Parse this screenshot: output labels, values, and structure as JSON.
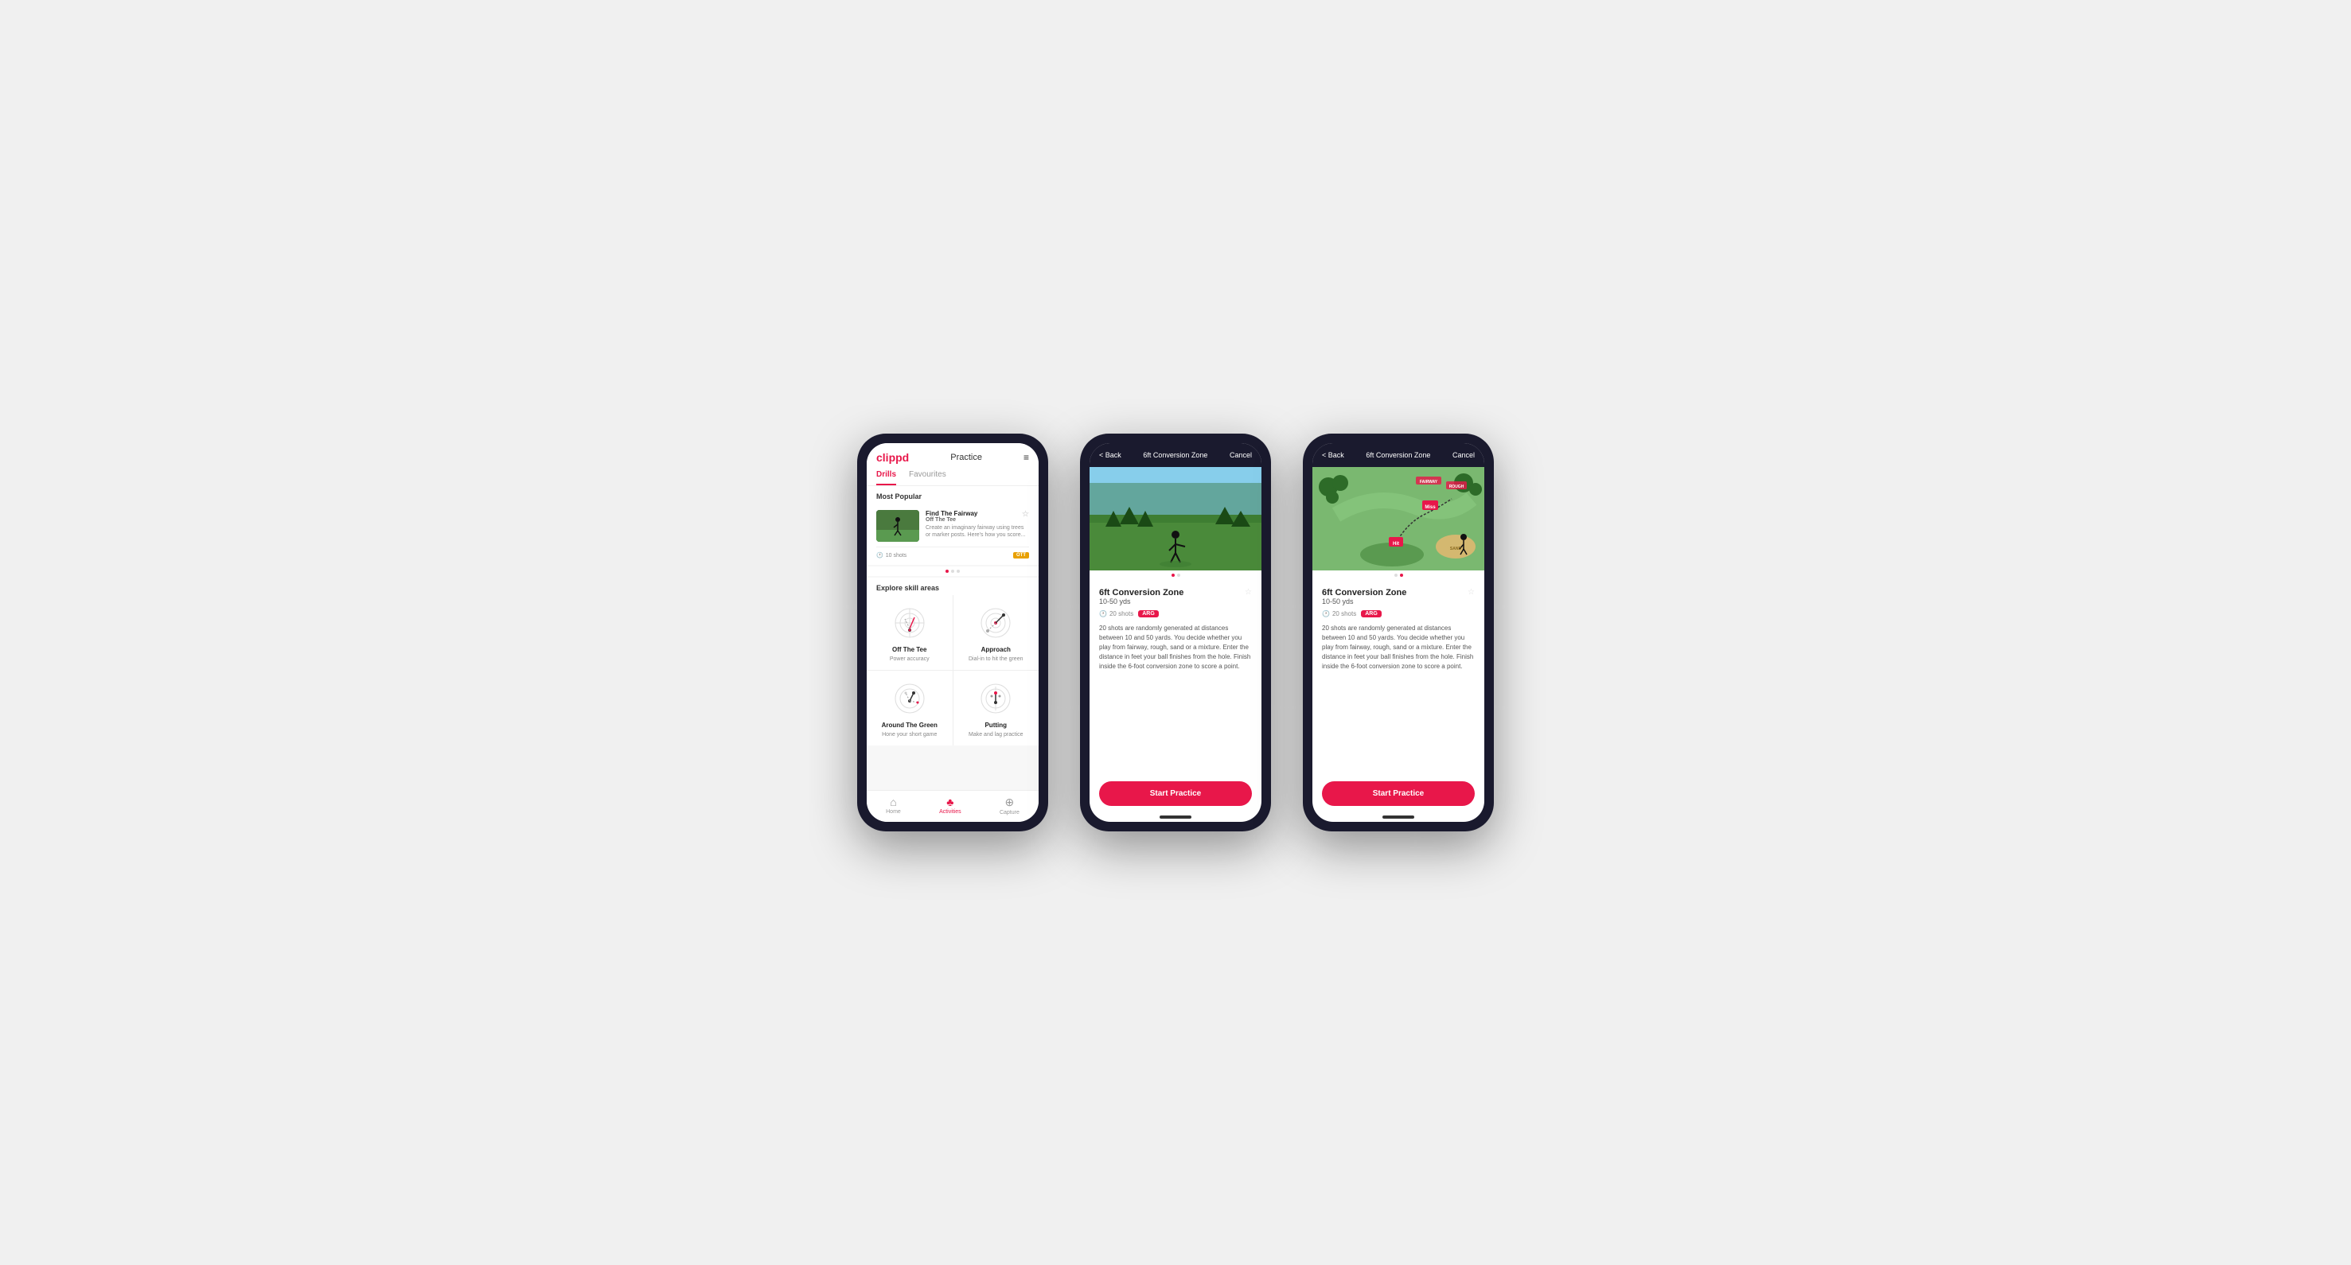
{
  "phone1": {
    "header": {
      "logo": "clippd",
      "nav_title": "Practice",
      "menu_icon": "≡"
    },
    "tabs": [
      {
        "label": "Drills",
        "active": true
      },
      {
        "label": "Favourites",
        "active": false
      }
    ],
    "most_popular_label": "Most Popular",
    "featured_drill": {
      "title": "Find The Fairway",
      "subtitle": "Off The Tee",
      "description": "Create an imaginary fairway using trees or marker posts. Here's how you score...",
      "shots": "10 shots",
      "badge": "OTT"
    },
    "explore_label": "Explore skill areas",
    "skill_areas": [
      {
        "name": "Off The Tee",
        "desc": "Power accuracy"
      },
      {
        "name": "Approach",
        "desc": "Dial-in to hit the green"
      },
      {
        "name": "Around The Green",
        "desc": "Hone your short game"
      },
      {
        "name": "Putting",
        "desc": "Make and lag practice"
      }
    ],
    "nav": [
      {
        "label": "Home",
        "icon": "⌂",
        "active": false
      },
      {
        "label": "Activities",
        "icon": "♣",
        "active": true
      },
      {
        "label": "Capture",
        "icon": "⊕",
        "active": false
      }
    ]
  },
  "phone2": {
    "header": {
      "back_label": "< Back",
      "title": "6ft Conversion Zone",
      "cancel_label": "Cancel"
    },
    "drill": {
      "title": "6ft Conversion Zone",
      "range": "10-50 yds",
      "shots": "20 shots",
      "badge": "ARG",
      "description": "20 shots are randomly generated at distances between 10 and 50 yards. You decide whether you play from fairway, rough, sand or a mixture. Enter the distance in feet your ball finishes from the hole. Finish inside the 6-foot conversion zone to score a point."
    },
    "start_button": "Start Practice",
    "image_type": "photo"
  },
  "phone3": {
    "header": {
      "back_label": "< Back",
      "title": "6ft Conversion Zone",
      "cancel_label": "Cancel"
    },
    "drill": {
      "title": "6ft Conversion Zone",
      "range": "10-50 yds",
      "shots": "20 shots",
      "badge": "ARG",
      "description": "20 shots are randomly generated at distances between 10 and 50 yards. You decide whether you play from fairway, rough, sand or a mixture. Enter the distance in feet your ball finishes from the hole. Finish inside the 6-foot conversion zone to score a point."
    },
    "start_button": "Start Practice",
    "image_type": "map"
  }
}
